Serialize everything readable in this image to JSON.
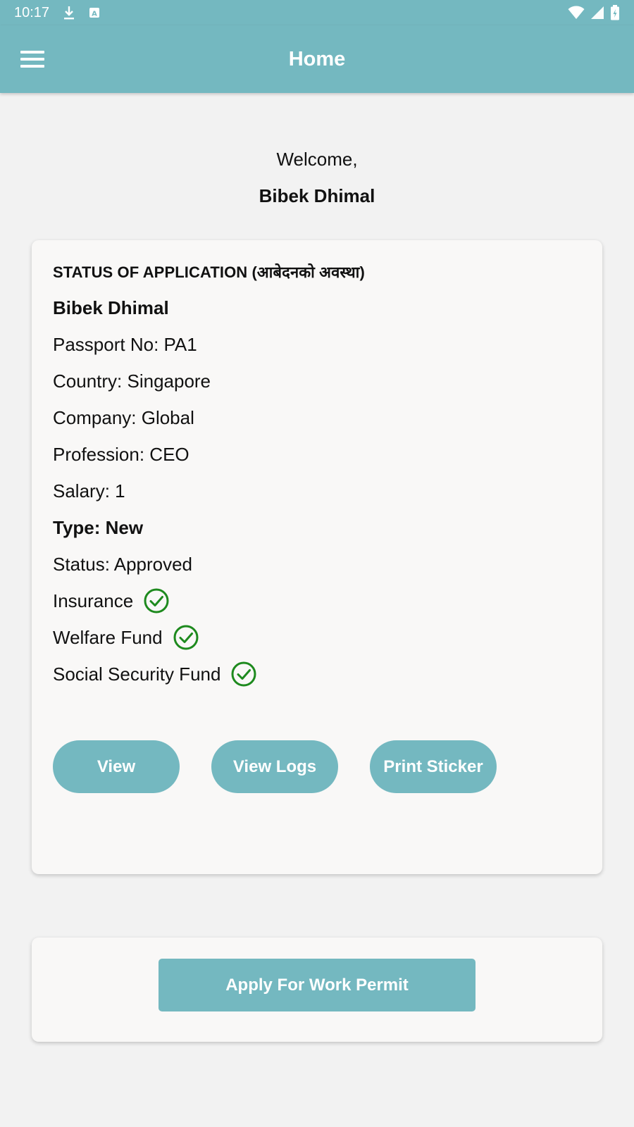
{
  "status_bar": {
    "time": "10:17",
    "icons": [
      "download-icon",
      "text-a-icon",
      "wifi-icon",
      "signal-icon",
      "battery-icon"
    ]
  },
  "app_bar": {
    "title": "Home",
    "menu_icon": "hamburger-menu-icon"
  },
  "welcome": {
    "greeting": "Welcome,",
    "name": "Bibek Dhimal"
  },
  "application": {
    "heading": "STATUS OF APPLICATION (आबेदनको अवस्था)",
    "name": "Bibek Dhimal",
    "passport": "Passport No: PA1",
    "country": "Country: Singapore",
    "company": "Company: Global",
    "profession": "Profession: CEO",
    "salary": "Salary: 1",
    "type": "Type: New",
    "status": "Status: Approved",
    "checks": [
      {
        "label": "Insurance",
        "icon": "check-circle-icon"
      },
      {
        "label": "Welfare Fund",
        "icon": "check-circle-icon"
      },
      {
        "label": "Social Security Fund",
        "icon": "check-circle-icon"
      }
    ],
    "buttons": {
      "view": "View",
      "view_logs": "View Logs",
      "print_sticker": "Print Sticker"
    }
  },
  "apply": {
    "button": "Apply For Work Permit"
  },
  "colors": {
    "primary": "#74b8c0",
    "check": "#1e8a1e",
    "background": "#f2f2f2",
    "card": "#f9f8f7"
  }
}
